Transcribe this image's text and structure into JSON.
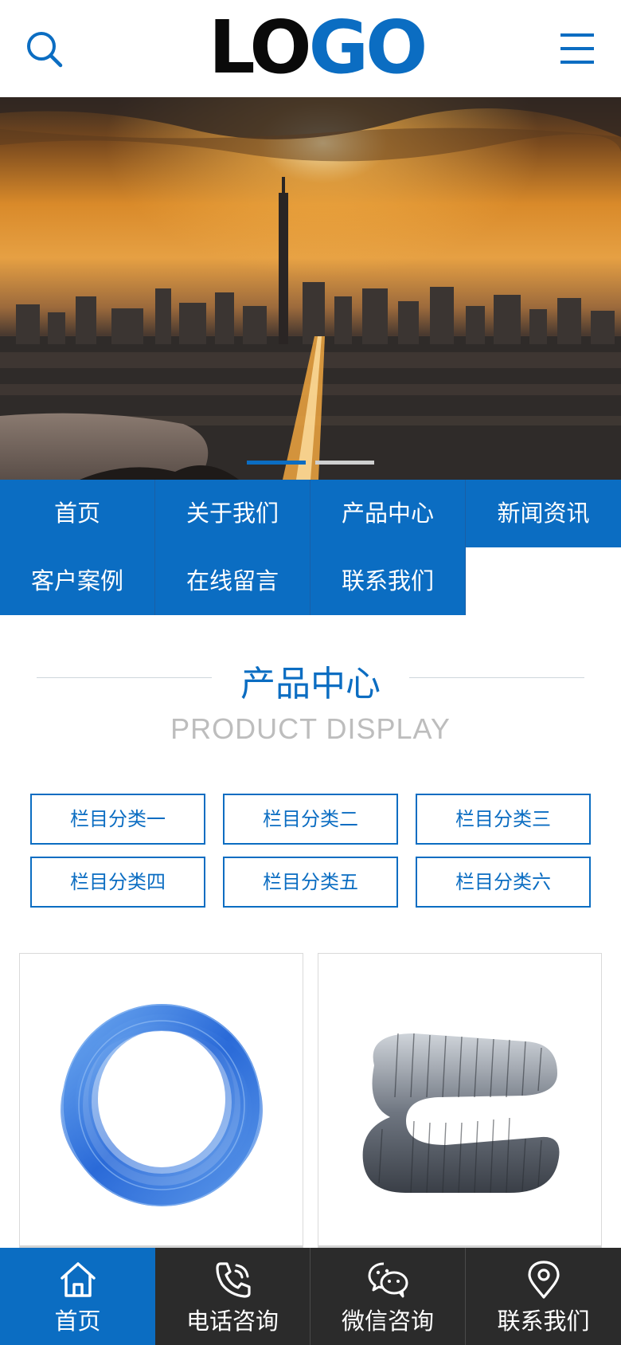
{
  "header": {
    "logo_part1": "LO",
    "logo_part2": "GO",
    "search_icon": "search-icon",
    "menu_icon": "hamburger-menu-icon"
  },
  "banner": {
    "image": "city-sunset-skyline",
    "slides": 2,
    "active_slide": 1
  },
  "nav": {
    "items": [
      {
        "label": "首页"
      },
      {
        "label": "关于我们"
      },
      {
        "label": "产品中心"
      },
      {
        "label": "新闻资讯"
      },
      {
        "label": "客户案例"
      },
      {
        "label": "在线留言"
      },
      {
        "label": "联系我们"
      }
    ]
  },
  "section": {
    "title_cn": "产品中心",
    "title_en": "PRODUCT DISPLAY"
  },
  "categories": [
    {
      "label": "栏目分类一"
    },
    {
      "label": "栏目分类二"
    },
    {
      "label": "栏目分类三"
    },
    {
      "label": "栏目分类四"
    },
    {
      "label": "栏目分类五"
    },
    {
      "label": "栏目分类六"
    }
  ],
  "products": [
    {
      "image": "blue-braided-hose-coil"
    },
    {
      "image": "silver-flexible-duct"
    }
  ],
  "bottom_bar": {
    "tabs": [
      {
        "label": "首页",
        "icon": "home-icon"
      },
      {
        "label": "电话咨询",
        "icon": "phone-icon"
      },
      {
        "label": "微信咨询",
        "icon": "wechat-icon"
      },
      {
        "label": "联系我们",
        "icon": "location-pin-icon"
      }
    ]
  },
  "colors": {
    "brand_blue": "#0b6dc2",
    "dark_bar": "#2b2b2b",
    "subtitle_grey": "#bdbdbd"
  }
}
